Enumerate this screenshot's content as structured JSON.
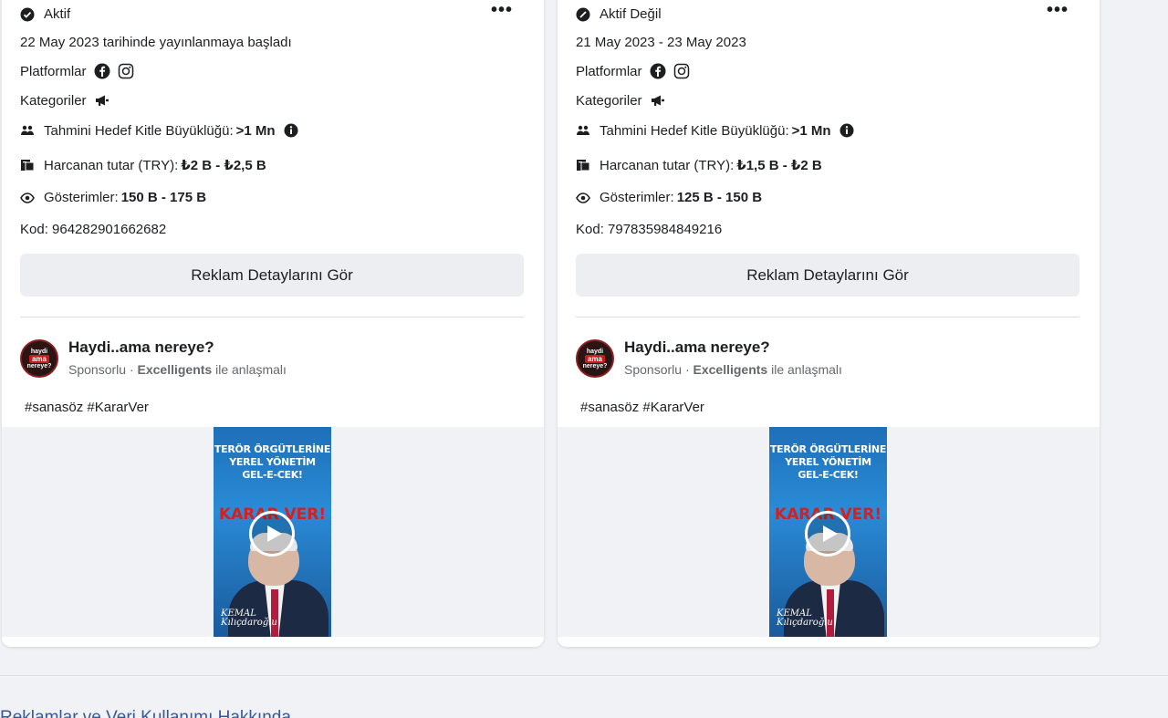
{
  "cards": [
    {
      "status": "Aktif",
      "status_icon": "check-circle-icon",
      "date_line": "22 May 2023 tarihinde yayınlanmaya başladı",
      "platforms_label": "Platformlar",
      "categories_label": "Kategoriler",
      "audience_label": "Tahmini Hedef Kitle Büyüklüğü:",
      "audience_value": ">1 Mn",
      "spend_label": "Harcanan tutar (TRY):",
      "spend_value": "₺2 B - ₺2,5 B",
      "impressions_label": "Gösterimler:",
      "impressions_value": "150 B - 175 B",
      "id_line": "Kod: 964282901662682",
      "details_button": "Reklam Detaylarını Gör",
      "page_name": "Haydi..ama nereye?",
      "sponsored": "Sponsorlu",
      "separator": "·",
      "partner": "Excelligents",
      "partner_suffix": "ile anlaşmalı",
      "hashtags": "#sanasöz #KararVer",
      "more_label": "•••",
      "avatar_lines": [
        "haydi",
        "ama",
        "nereye?"
      ],
      "poster_text": [
        "TERÖR ÖRGÜTLERİNE",
        "YEREL YÖNETİM",
        "GEL-E-CEK!"
      ],
      "poster_red": "KARAR VER!",
      "poster_signature": [
        "KEMAL",
        "Kılıçdaroğlu"
      ]
    },
    {
      "status": "Aktif Değil",
      "status_icon": "not-active-icon",
      "date_line": "21 May 2023 - 23 May 2023",
      "platforms_label": "Platformlar",
      "categories_label": "Kategoriler",
      "audience_label": "Tahmini Hedef Kitle Büyüklüğü:",
      "audience_value": ">1 Mn",
      "spend_label": "Harcanan tutar (TRY):",
      "spend_value": "₺1,5 B - ₺2 B",
      "impressions_label": "Gösterimler:",
      "impressions_value": "125 B - 150 B",
      "id_line": "Kod: 797835984849216",
      "details_button": "Reklam Detaylarını Gör",
      "page_name": "Haydi..ama nereye?",
      "sponsored": "Sponsorlu",
      "separator": "·",
      "partner": "Excelligents",
      "partner_suffix": "ile anlaşmalı",
      "hashtags": "#sanasöz #KararVer",
      "more_label": "•••",
      "avatar_lines": [
        "haydi",
        "ama",
        "nereye?"
      ],
      "poster_text": [
        "TERÖR ÖRGÜTLERİNE",
        "YEREL YÖNETİM",
        "GEL-E-CEK!"
      ],
      "poster_red": "KARAR VER!",
      "poster_signature": [
        "KEMAL",
        "Kılıçdaroğlu"
      ]
    }
  ],
  "footer": {
    "link": "Reklamlar ve Veri Kullanımı Hakkında"
  },
  "colors": {
    "background": "#f0f2f5",
    "card": "#ffffff",
    "link": "#385898",
    "muted": "#65676b"
  }
}
